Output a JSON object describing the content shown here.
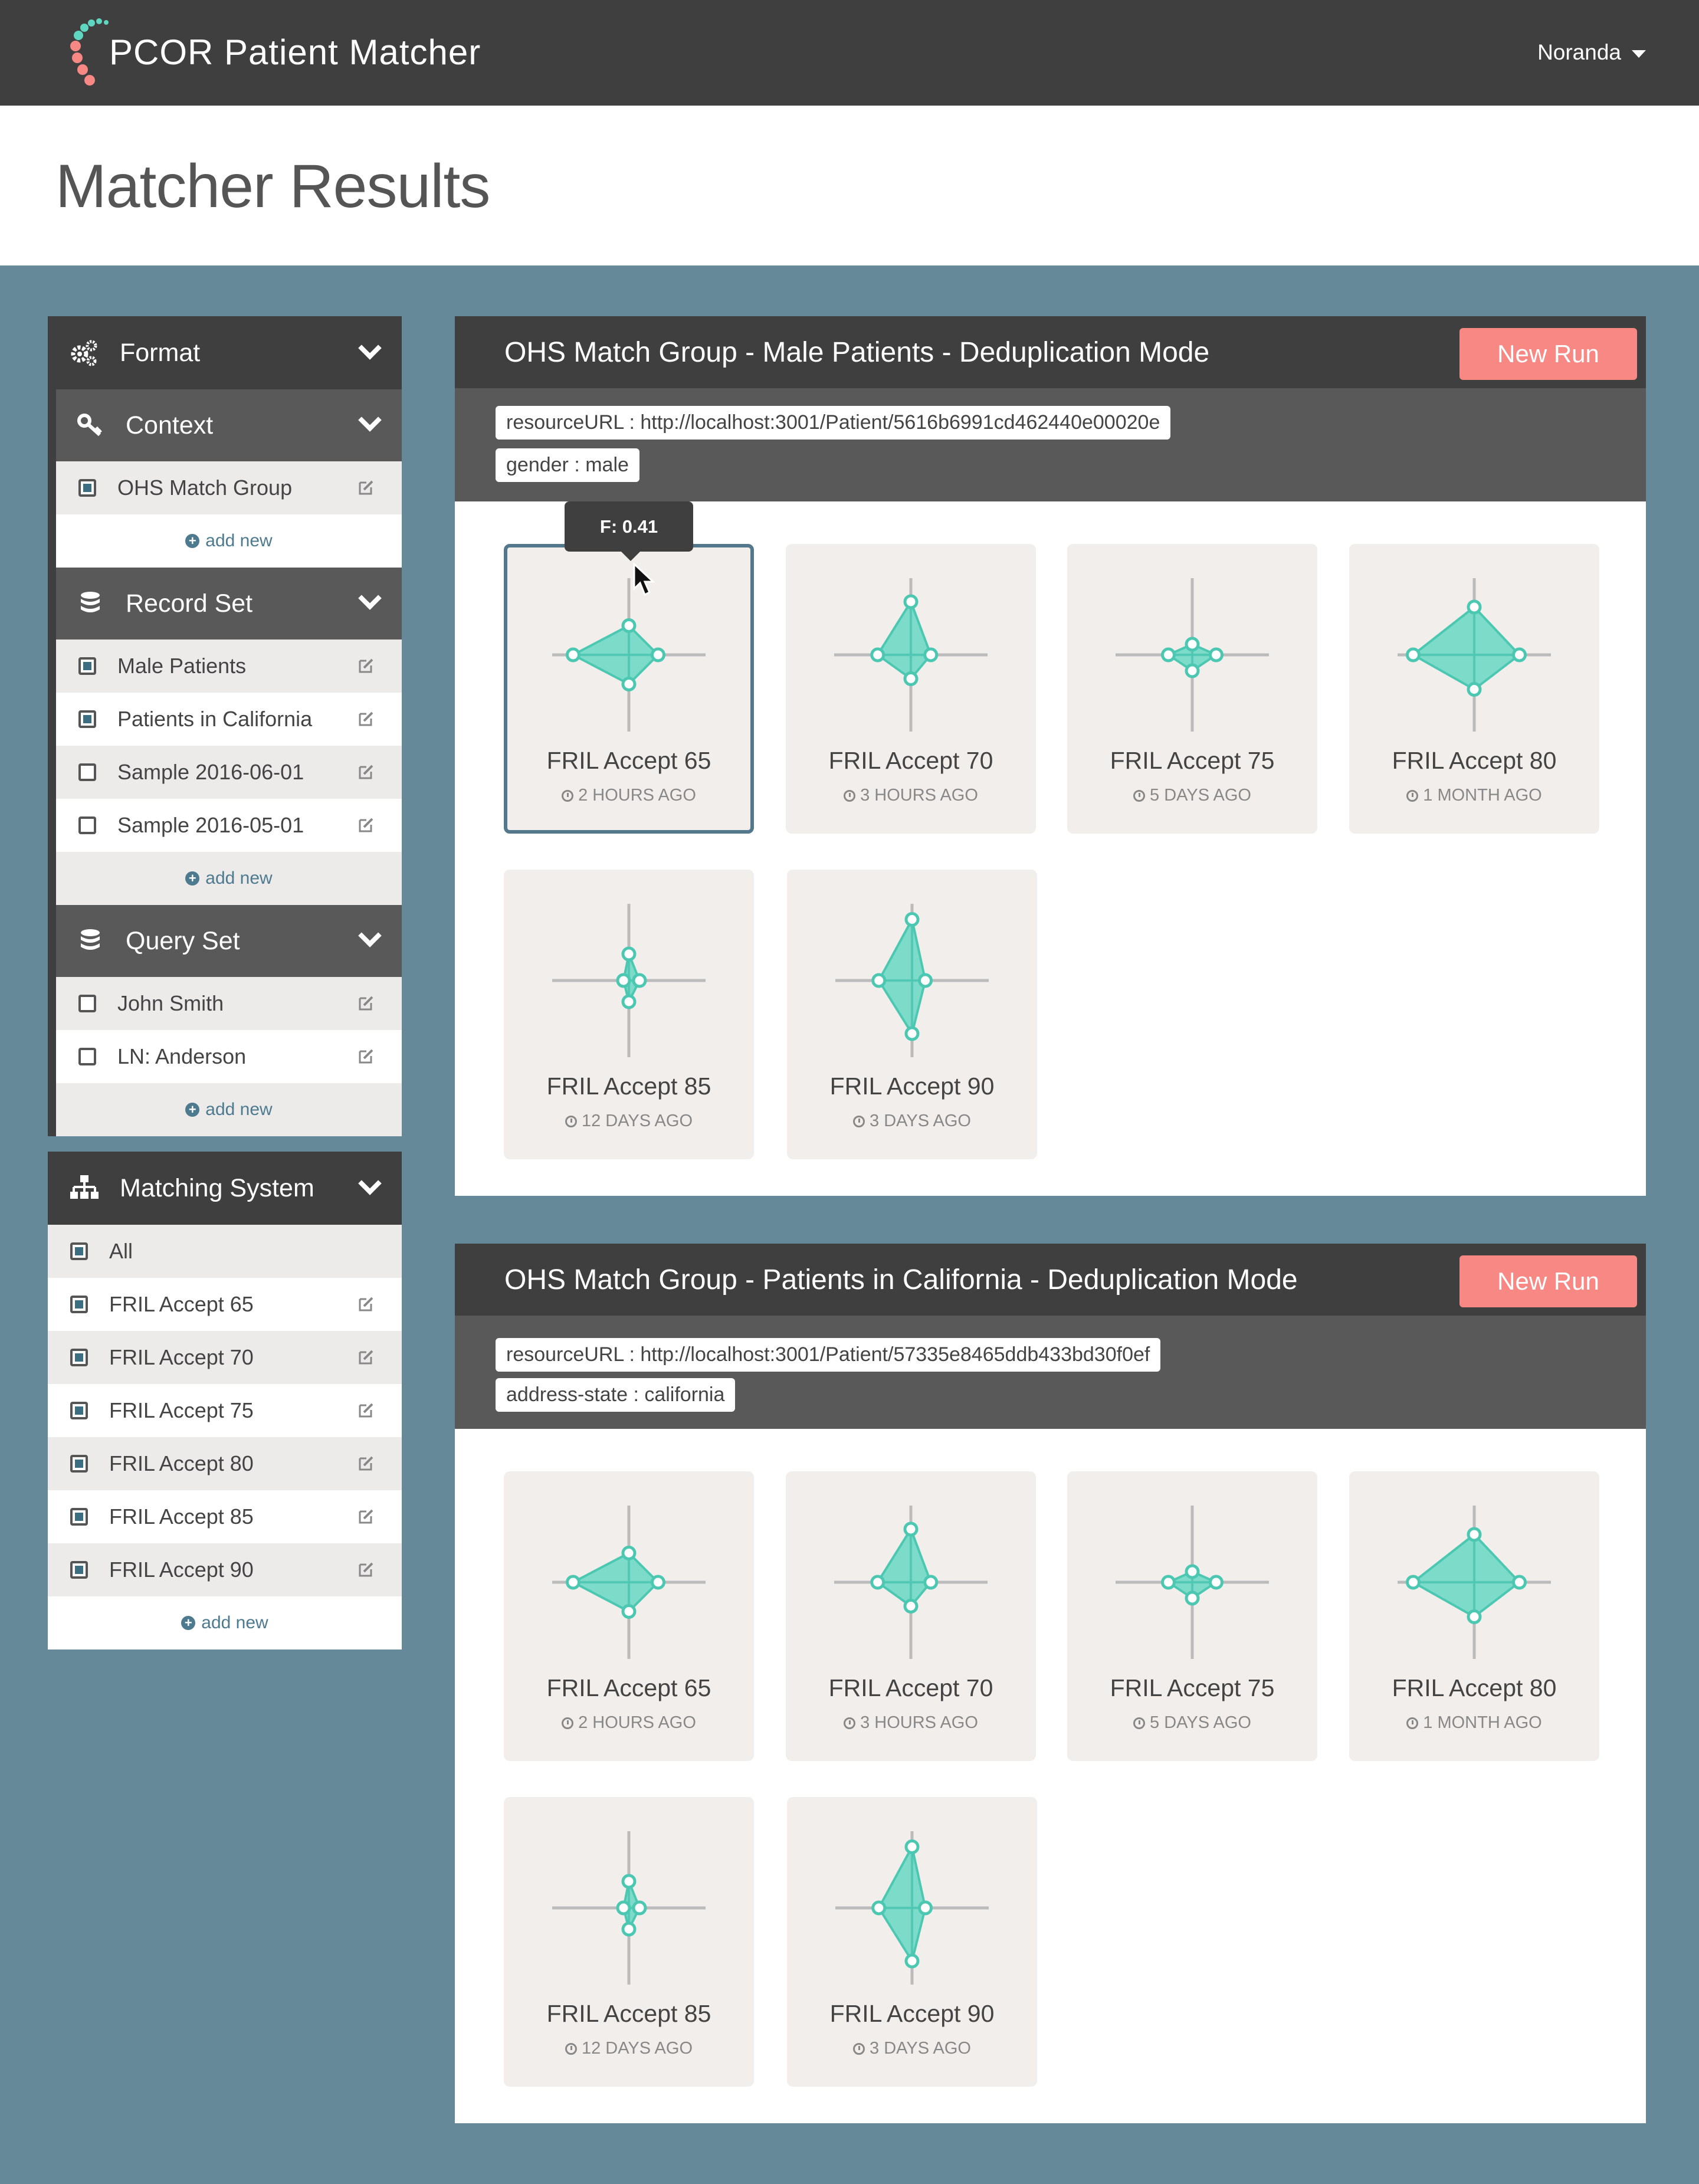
{
  "app": {
    "title": "PCOR Patient Matcher",
    "user": "Noranda",
    "page_title": "Matcher Results",
    "accent": "#f78884",
    "chart_fill": "#5fd6c1"
  },
  "sidebar": {
    "format": {
      "label": "Format"
    },
    "context": {
      "label": "Context",
      "items": [
        {
          "label": "OHS Match Group",
          "checked": true
        }
      ],
      "add_label": "add new"
    },
    "record_set": {
      "label": "Record Set",
      "items": [
        {
          "label": "Male Patients",
          "checked": true
        },
        {
          "label": "Patients in California",
          "checked": true
        },
        {
          "label": "Sample 2016-06-01",
          "checked": false
        },
        {
          "label": "Sample 2016-05-01",
          "checked": false
        }
      ],
      "add_label": "add new"
    },
    "query_set": {
      "label": "Query Set",
      "items": [
        {
          "label": "John Smith",
          "checked": false
        },
        {
          "label": "LN: Anderson",
          "checked": false
        }
      ],
      "add_label": "add new"
    },
    "matching_system": {
      "label": "Matching System",
      "items": [
        {
          "label": "All",
          "checked": true
        },
        {
          "label": "FRIL Accept 65",
          "checked": true
        },
        {
          "label": "FRIL Accept 70",
          "checked": true
        },
        {
          "label": "FRIL Accept 75",
          "checked": true
        },
        {
          "label": "FRIL Accept 80",
          "checked": true
        },
        {
          "label": "FRIL Accept 85",
          "checked": true
        },
        {
          "label": "FRIL Accept 90",
          "checked": true
        }
      ],
      "add_label": "add new"
    }
  },
  "panels": [
    {
      "title": "OHS Match Group - Male Patients - Deduplication Mode",
      "new_run_label": "New Run",
      "params": [
        "resourceURL :  http://localhost:3001/Patient/5616b6991cd462440e00020e",
        "gender :  male"
      ],
      "tooltip": "F: 0.41",
      "cards": [
        {
          "name": "FRIL Accept 65",
          "time": "2 HOURS AGO"
        },
        {
          "name": "FRIL Accept 70",
          "time": "3 HOURS AGO"
        },
        {
          "name": "FRIL Accept 75",
          "time": "5 DAYS AGO"
        },
        {
          "name": "FRIL Accept 80",
          "time": "1 MONTH AGO"
        },
        {
          "name": "FRIL Accept 85",
          "time": "12 DAYS AGO"
        },
        {
          "name": "FRIL Accept 90",
          "time": "3 DAYS AGO"
        }
      ]
    },
    {
      "title": "OHS Match Group - Patients in California - Deduplication Mode",
      "new_run_label": "New Run",
      "params": [
        "resourceURL :  http://localhost:3001/Patient/57335e8465ddb433bd30f0ef",
        "address-state : california"
      ],
      "cards": [
        {
          "name": "FRIL Accept 65",
          "time": "2 HOURS AGO"
        },
        {
          "name": "FRIL Accept 70",
          "time": "3 HOURS AGO"
        },
        {
          "name": "FRIL Accept 75",
          "time": "5 DAYS AGO"
        },
        {
          "name": "FRIL Accept 80",
          "time": "1 MONTH AGO"
        },
        {
          "name": "FRIL Accept 85",
          "time": "12 DAYS AGO"
        },
        {
          "name": "FRIL Accept 90",
          "time": "3 DAYS AGO"
        }
      ]
    }
  ]
}
